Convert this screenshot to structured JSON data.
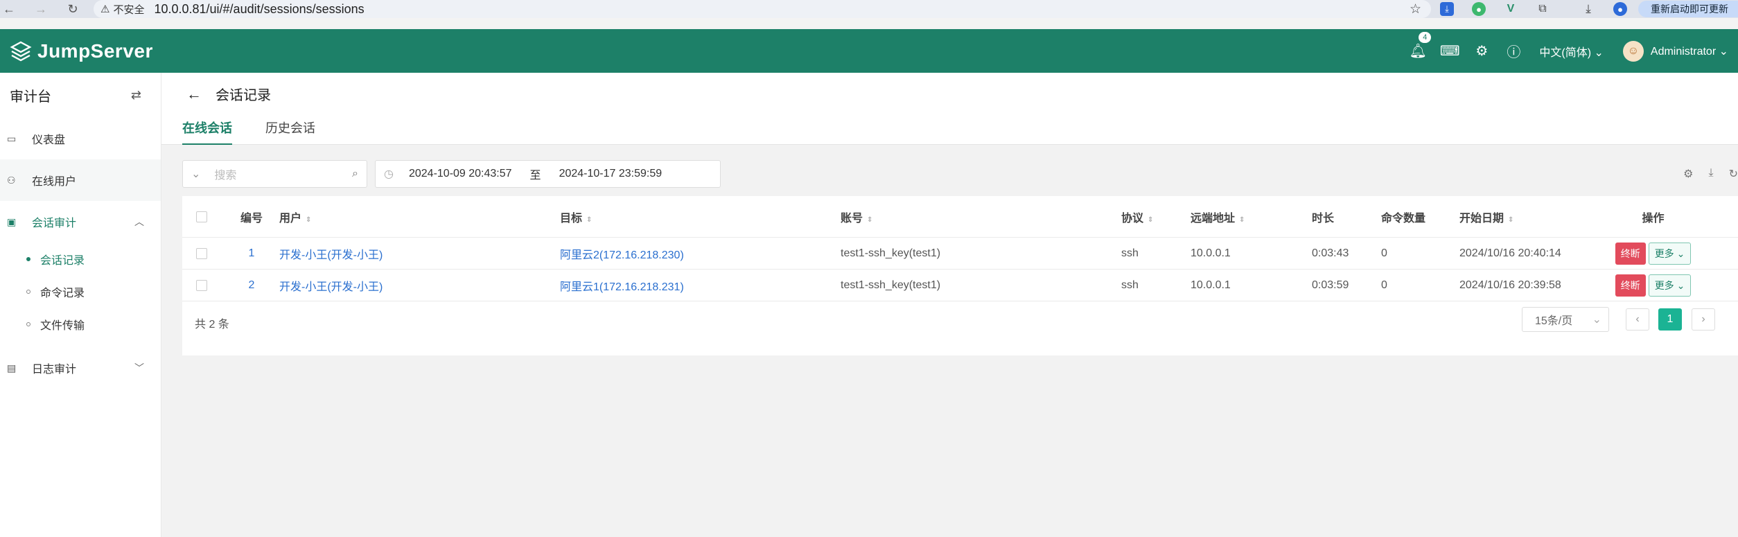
{
  "browser": {
    "security_label": "不安全",
    "url": "10.0.0.81/ui/#/audit/sessions/sessions",
    "update_label": "重新启动即可更新"
  },
  "header": {
    "logo": "JumpServer",
    "notification_count": "4",
    "language": "中文(简体)",
    "user": "Administrator"
  },
  "sidebar": {
    "title": "审计台",
    "items": [
      {
        "label": "仪表盘"
      },
      {
        "label": "在线用户"
      },
      {
        "label": "会话审计"
      },
      {
        "label": "日志审计"
      }
    ],
    "subitems": [
      {
        "label": "会话记录"
      },
      {
        "label": "命令记录"
      },
      {
        "label": "文件传输"
      }
    ]
  },
  "page": {
    "title": "会话记录",
    "tabs": [
      {
        "label": "在线会话"
      },
      {
        "label": "历史会话"
      }
    ]
  },
  "filters": {
    "search_placeholder": "搜索",
    "date_from": "2024-10-09 20:43:57",
    "date_sep": "至",
    "date_to": "2024-10-17 23:59:59"
  },
  "table": {
    "headers": {
      "index": "编号",
      "user": "用户",
      "target": "目标",
      "account": "账号",
      "protocol": "协议",
      "remote": "远端地址",
      "duration": "时长",
      "commands": "命令数量",
      "start": "开始日期",
      "actions": "操作"
    },
    "rows": [
      {
        "index": "1",
        "user": "开发-小王(开发-小王)",
        "target": "阿里云2(172.16.218.230)",
        "account": "test1-ssh_key(test1)",
        "protocol": "ssh",
        "remote": "10.0.0.1",
        "duration": "0:03:43",
        "commands": "0",
        "start": "2024/10/16 20:40:14"
      },
      {
        "index": "2",
        "user": "开发-小王(开发-小王)",
        "target": "阿里云1(172.16.218.231)",
        "account": "test1-ssh_key(test1)",
        "protocol": "ssh",
        "remote": "10.0.0.1",
        "duration": "0:03:59",
        "commands": "0",
        "start": "2024/10/16 20:39:58"
      }
    ],
    "terminate_label": "终断",
    "more_label": "更多"
  },
  "pagination": {
    "total": "共 2 条",
    "page_size": "15条/页",
    "current_page": "1"
  }
}
